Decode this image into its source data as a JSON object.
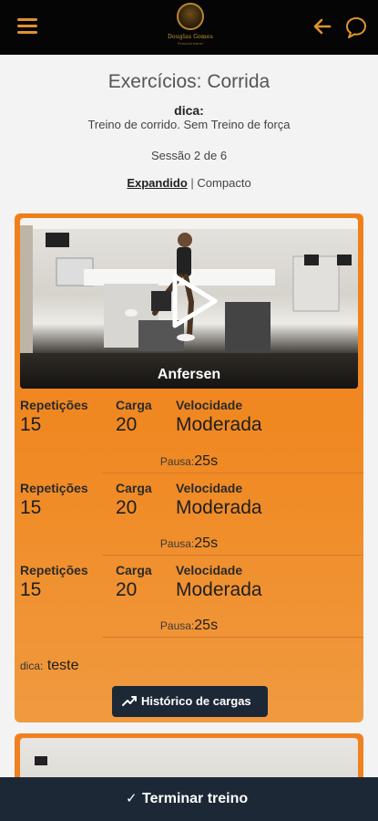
{
  "header": {
    "title": "Exercícios: Corrida",
    "tip_label": "dica:",
    "tip_text": "Treino de corrido. Sem Treino de força",
    "session": "Sessão 2 de 6",
    "view_expanded": "Expandido",
    "view_separator": "|",
    "view_compact": "Compacto"
  },
  "logo": {
    "text": "Douglas Gomes",
    "subtext": "Personal trainer"
  },
  "icons": {
    "menu": "menu-icon",
    "back": "arrow-left-icon",
    "chat": "chat-icon",
    "play": "play-icon",
    "history": "trending-up-icon",
    "finish": "check-icon"
  },
  "colors": {
    "topbar": "#050505",
    "accent": "#e0922e",
    "card": "#f08a24",
    "dark_button": "#1d2836"
  },
  "exercise": {
    "name": "Anfersen",
    "labels": {
      "reps": "Repetições",
      "load": "Carga",
      "speed": "Velocidade",
      "pause": "Pausa:"
    },
    "sets": [
      {
        "reps": "15",
        "load": "20",
        "speed": "Moderada",
        "pause": "25s"
      },
      {
        "reps": "15",
        "load": "20",
        "speed": "Moderada",
        "pause": "25s"
      },
      {
        "reps": "15",
        "load": "20",
        "speed": "Moderada",
        "pause": "25s"
      }
    ],
    "tip_label": "dica:",
    "tip_value": "teste",
    "history_button": "Histórico de cargas"
  },
  "footer": {
    "finish_icon": "✓",
    "finish_label": "Terminar treino"
  }
}
